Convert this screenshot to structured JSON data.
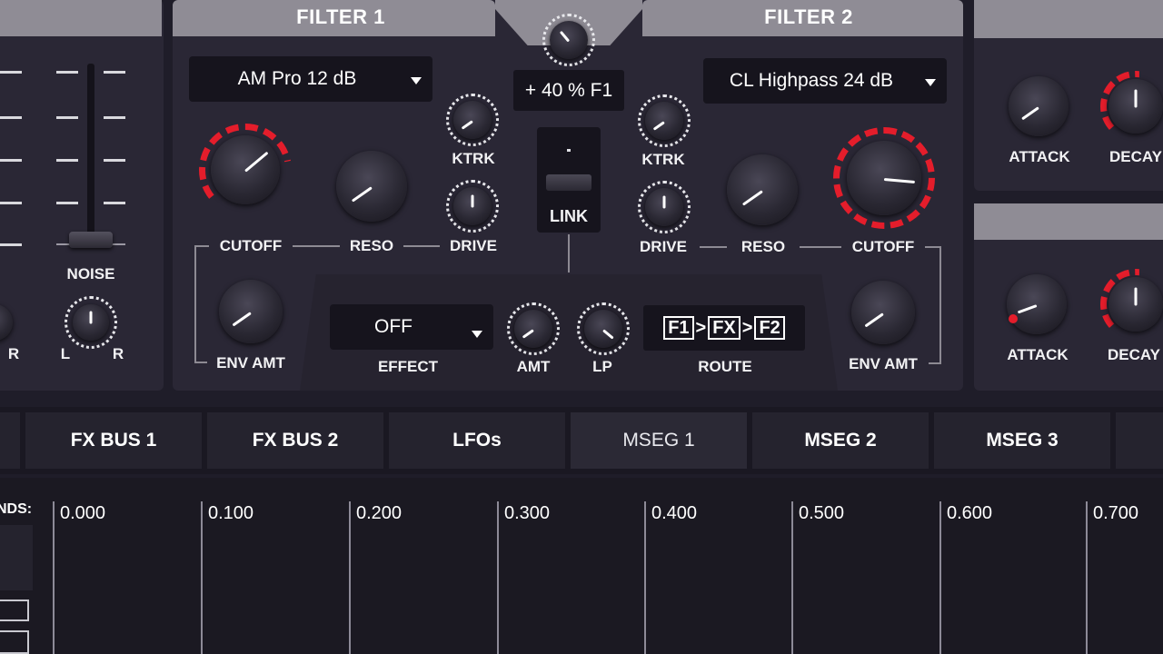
{
  "filter1": {
    "title": "FILTER 1",
    "type": "AM Pro 12 dB",
    "ktrk_label": "KTRK",
    "drive_label": "DRIVE",
    "cutoff_label": "CUTOFF",
    "reso_label": "RESO",
    "env_amt_label": "ENV AMT"
  },
  "filter2": {
    "title": "FILTER 2",
    "type": "CL Highpass 24 dB",
    "ktrk_label": "KTRK",
    "drive_label": "DRIVE",
    "cutoff_label": "CUTOFF",
    "reso_label": "RESO",
    "env_amt_label": "ENV AMT"
  },
  "center": {
    "balance_value": "+ 40 % F1",
    "link_label": "LINK"
  },
  "effect": {
    "value": "OFF",
    "label": "EFFECT",
    "amt_label": "AMT",
    "lp_label": "LP",
    "route_label": "ROUTE",
    "route_f1": "F1",
    "route_fx": "FX",
    "route_f2": "F2",
    "route_sep": ">"
  },
  "left": {
    "noise_label": "NOISE",
    "pan_l": "L",
    "pan_r": "R",
    "r_label_left": "R"
  },
  "envelopes": {
    "attack_label": "ATTACK",
    "decay_label": "DECAY"
  },
  "tabs": [
    "FX BUS 1",
    "FX BUS 2",
    "LFOs",
    "MSEG 1",
    "MSEG 2",
    "MSEG 3"
  ],
  "active_tab": "MSEG 1",
  "mseg": {
    "left_label": "NDS:",
    "grid_labels": [
      "0.000",
      "0.100",
      "0.200",
      "0.300",
      "0.400",
      "0.500",
      "0.600",
      "0.700"
    ]
  },
  "colors": {
    "accent_red": "#e41d2b",
    "panel": "#2a2735",
    "header": "#8f8c95"
  }
}
